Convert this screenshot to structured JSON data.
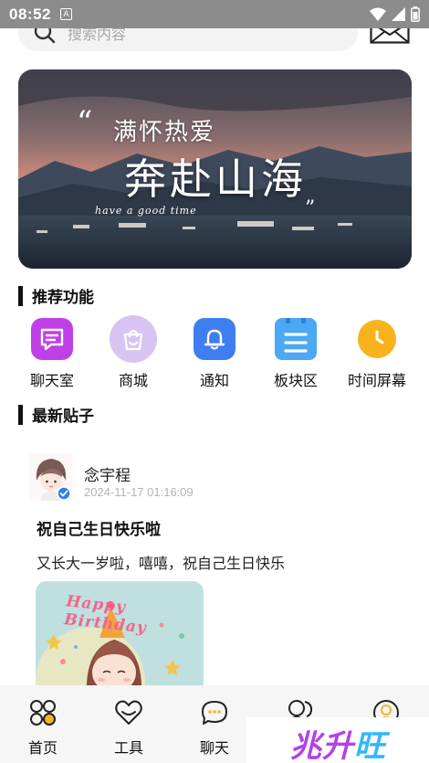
{
  "status_bar": {
    "time": "08:52",
    "notification_glyph": "A"
  },
  "search": {
    "placeholder": "搜索内容"
  },
  "banner": {
    "line1": "满怀热爱",
    "line2": "奔赴山海",
    "tagline": "have a good time",
    "quote_open": "“",
    "quote_close": "”"
  },
  "sections": {
    "features_title": "推荐功能",
    "posts_title": "最新贴子"
  },
  "features": [
    {
      "label": "聊天室",
      "icon": "chat-room-icon",
      "color": "#c040e8"
    },
    {
      "label": "商城",
      "icon": "shopping-bag-icon",
      "color": "#d8c4f2"
    },
    {
      "label": "通知",
      "icon": "bell-icon",
      "color": "#3f7ef0"
    },
    {
      "label": "板块区",
      "icon": "board-list-icon",
      "color": "#4aa8f4"
    },
    {
      "label": "时间屏幕",
      "icon": "clock-icon",
      "color": "#f7b21c"
    }
  ],
  "post": {
    "author": "念宇程",
    "time": "2024-11-17 01:16:09",
    "title": "祝自己生日快乐啦",
    "body": "又长大一岁啦，嘻嘻，祝自己生日快乐",
    "image_caption": "Happy Birthday"
  },
  "bottom_nav": [
    {
      "label": "首页",
      "icon": "home-grid-icon"
    },
    {
      "label": "工具",
      "icon": "heart-icon"
    },
    {
      "label": "聊天",
      "icon": "chat-bubble-icon"
    },
    {
      "label": "",
      "icon": "friends-icon"
    },
    {
      "label": "",
      "icon": "profile-icon"
    }
  ],
  "watermark": {
    "part1": "兆升",
    "part2": "旺"
  }
}
